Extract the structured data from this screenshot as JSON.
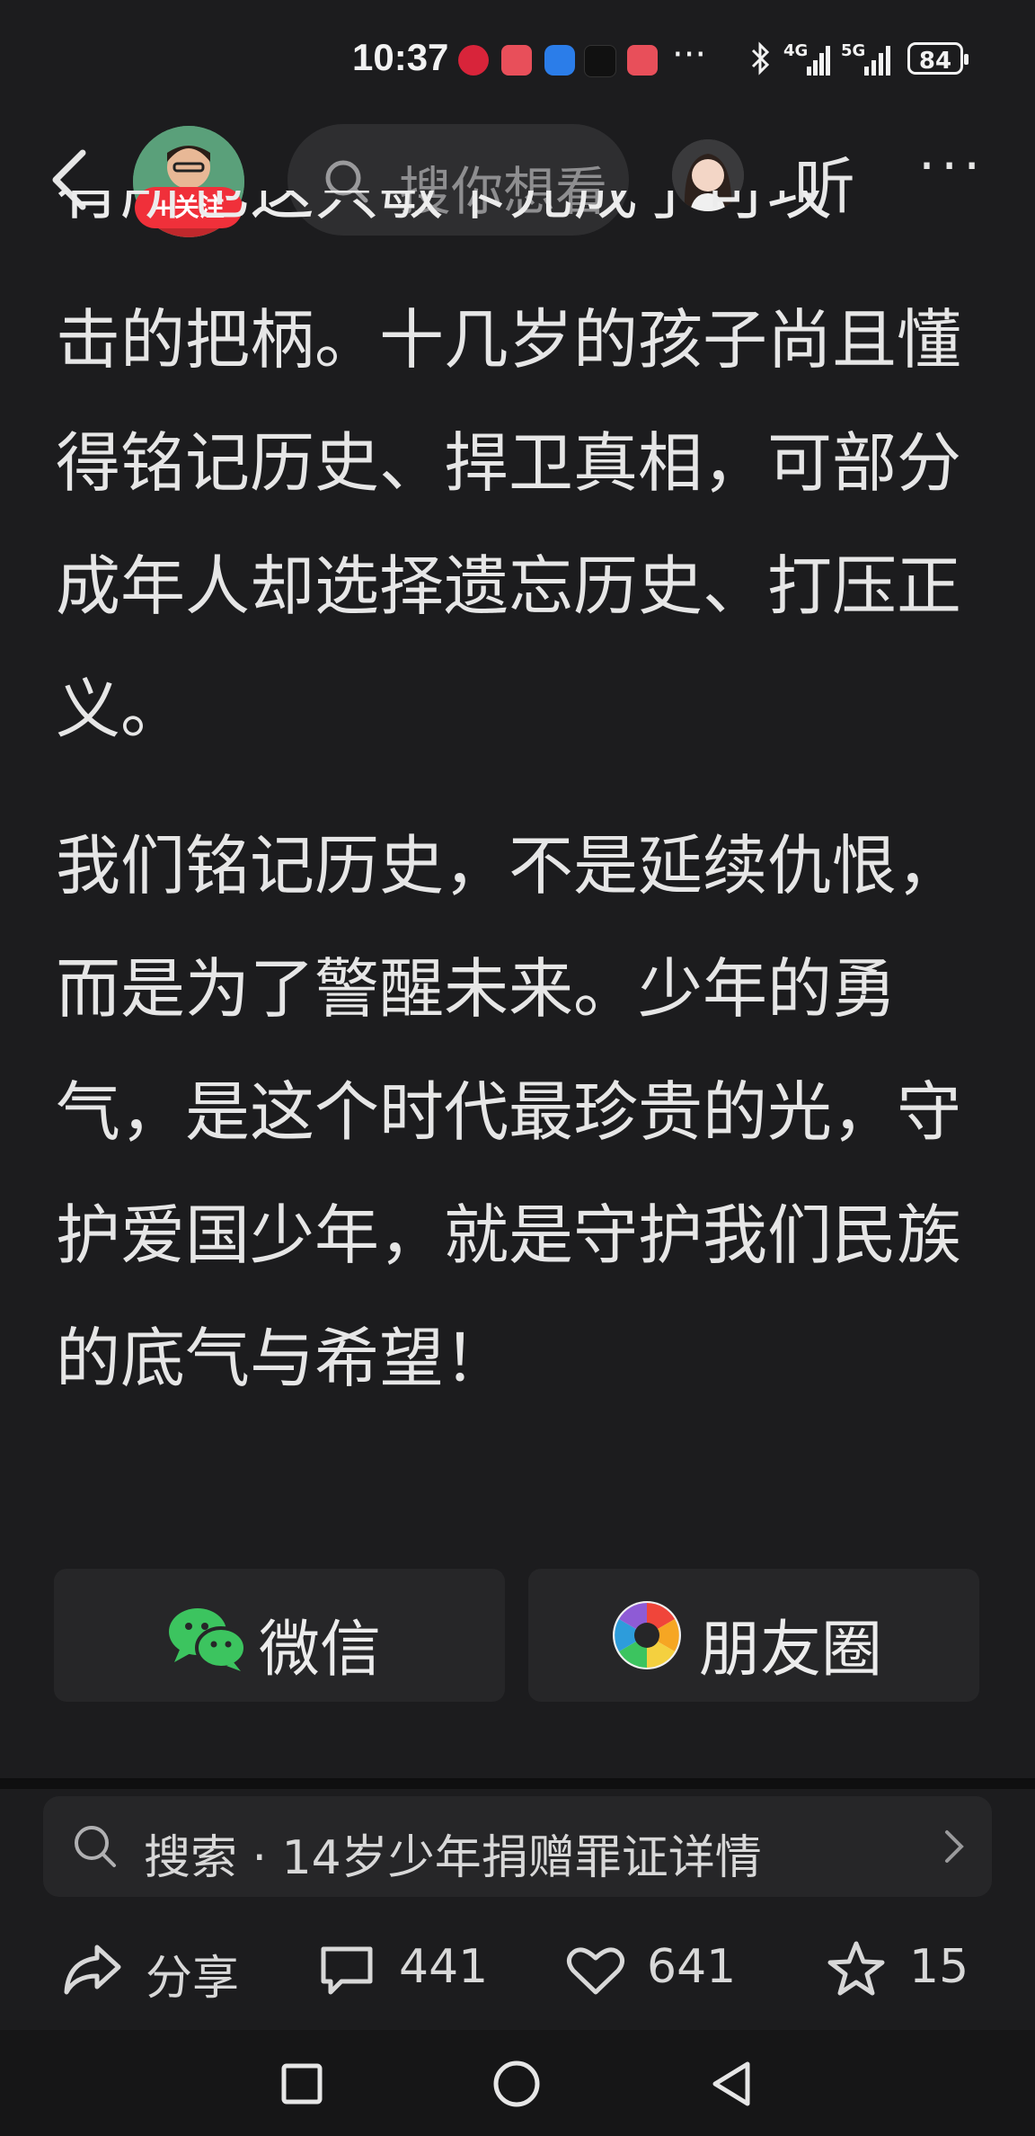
{
  "status": {
    "time": "10:37",
    "battery": "84",
    "sig1": "4G",
    "sig2": "5G"
  },
  "topbar": {
    "follow_label": "+关注",
    "search_placeholder": "搜你想看",
    "listen_label": "听",
    "more_label": "···"
  },
  "article": {
    "cut_line": "有所也这只敏卡元成了可攻",
    "p1": "击的把柄。十几岁的孩子尚且懂得铭记历史、捍卫真相，可部分成年人却选择遗忘历史、打压正义。",
    "p2": "我们铭记历史，不是延续仇恨，而是为了警醒未来。少年的勇气，是这个时代最珍贵的光，守护爱国少年，就是守护我们民族的底气与希望！"
  },
  "share": {
    "wechat_label": "微信",
    "moments_label": "朋友圈"
  },
  "suggest": {
    "text": "搜索 · 14岁少年捐赠罪证详情"
  },
  "actions": {
    "share_label": "分享",
    "comments": "441",
    "likes": "641",
    "favorites": "15"
  },
  "colors": {
    "background": "#1c1c1e",
    "follow_red": "#f0303a",
    "wechat_green": "#3cc45f"
  }
}
